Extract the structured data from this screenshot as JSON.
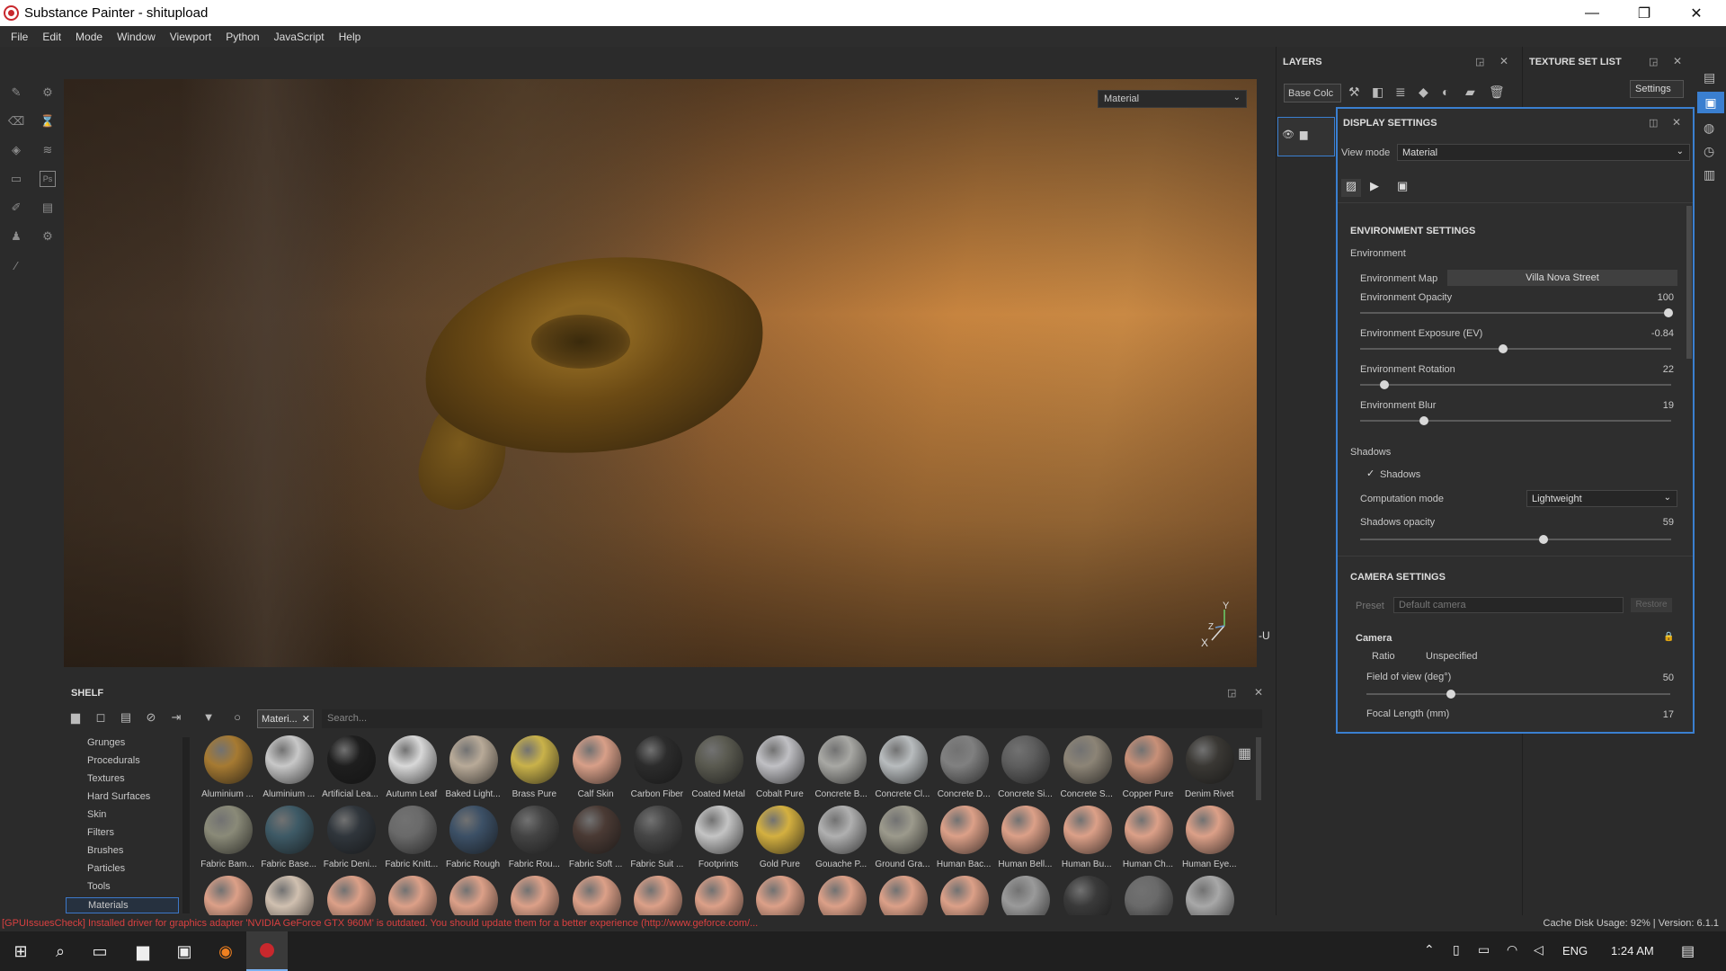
{
  "window": {
    "title": "Substance Painter - shitupload",
    "minimize": "—",
    "maximize": "❐",
    "close": "✕"
  },
  "menu": [
    "File",
    "Edit",
    "Mode",
    "Window",
    "Viewport",
    "Python",
    "JavaScript",
    "Help"
  ],
  "viewport": {
    "mode_dropdown": "Material",
    "axis_y": "Y",
    "axis_z": "Z",
    "axis_x": "X",
    "axis_u": "-U"
  },
  "shelf": {
    "title": "SHELF",
    "filter_chip": "Materi...",
    "search_placeholder": "Search...",
    "categories": [
      "Grunges",
      "Procedurals",
      "Textures",
      "Hard Surfaces",
      "Skin",
      "Filters",
      "Brushes",
      "Particles",
      "Tools",
      "Materials"
    ],
    "selected_category": "Materials",
    "materials_row1": [
      {
        "label": "Aluminium ...",
        "color": "#a67a32"
      },
      {
        "label": "Aluminium ...",
        "color": "#c8c8c8"
      },
      {
        "label": "Artificial Lea...",
        "color": "#1e1e1e"
      },
      {
        "label": "Autumn Leaf",
        "color": "#d8d8d8"
      },
      {
        "label": "Baked Light...",
        "color": "#b8aa98"
      },
      {
        "label": "Brass Pure",
        "color": "#c9b24a"
      },
      {
        "label": "Calf Skin",
        "color": "#d89f88"
      },
      {
        "label": "Carbon Fiber",
        "color": "#2c2c2c"
      },
      {
        "label": "Coated Metal",
        "color": "#5a5a50"
      },
      {
        "label": "Cobalt Pure",
        "color": "#c0c0c4"
      },
      {
        "label": "Concrete B...",
        "color": "#a8a8a4"
      },
      {
        "label": "Concrete Cl...",
        "color": "#b8bcbe"
      },
      {
        "label": "Concrete D...",
        "color": "#808080"
      },
      {
        "label": "Concrete Si...",
        "color": "#5e5e5e"
      },
      {
        "label": "Concrete S...",
        "color": "#8c8476"
      },
      {
        "label": "Copper Pure",
        "color": "#c89078"
      },
      {
        "label": "Denim Rivet",
        "color": "#3a3834"
      }
    ],
    "materials_row2": [
      {
        "label": "Fabric Bam...",
        "color": "#8a8a78"
      },
      {
        "label": "Fabric Base...",
        "color": "#3e5a66"
      },
      {
        "label": "Fabric Deni...",
        "color": "#30363c"
      },
      {
        "label": "Fabric Knitt...",
        "color": "#6a6a6a"
      },
      {
        "label": "Fabric Rough",
        "color": "#3c5066"
      },
      {
        "label": "Fabric Rou...",
        "color": "#444444"
      },
      {
        "label": "Fabric Soft ...",
        "color": "#4a3a34"
      },
      {
        "label": "Fabric Suit ...",
        "color": "#464646"
      },
      {
        "label": "Footprints",
        "color": "#c4c4c4"
      },
      {
        "label": "Gold Pure",
        "color": "#d4b040"
      },
      {
        "label": "Gouache P...",
        "color": "#b0b0b0"
      },
      {
        "label": "Ground Gra...",
        "color": "#9c9a8c"
      },
      {
        "label": "Human Bac...",
        "color": "#dca088"
      },
      {
        "label": "Human Bell...",
        "color": "#dca088"
      },
      {
        "label": "Human Bu...",
        "color": "#dca088"
      },
      {
        "label": "Human Ch...",
        "color": "#dca088"
      },
      {
        "label": "Human Eye...",
        "color": "#dca088"
      }
    ],
    "materials_row3": [
      "#dca088",
      "#d0c0b0",
      "#dca088",
      "#dca088",
      "#dca088",
      "#dca088",
      "#dca088",
      "#dca088",
      "#dca088",
      "#dca088",
      "#dca088",
      "#dca088",
      "#dca088",
      "#9a9a9a",
      "#3a3a3a",
      "#6a6a6a",
      "#a8a8a8"
    ]
  },
  "layers": {
    "title": "LAYERS",
    "channel": "Base Colc"
  },
  "texture_set": {
    "title": "TEXTURE SET LIST",
    "settings": "Settings"
  },
  "display_settings": {
    "title": "DISPLAY SETTINGS",
    "view_mode_label": "View mode",
    "view_mode": "Material",
    "env_section": "ENVIRONMENT SETTINGS",
    "env_group": "Environment",
    "env_map_label": "Environment Map",
    "env_map": "Villa Nova Street",
    "sliders": [
      {
        "label": "Environment Opacity",
        "value": "100",
        "fraction": 1.0
      },
      {
        "label": "Environment Exposure (EV)",
        "value": "-0.84",
        "fraction": 0.46
      },
      {
        "label": "Environment Rotation",
        "value": "22",
        "fraction": 0.07
      },
      {
        "label": "Environment Blur",
        "value": "19",
        "fraction": 0.2
      }
    ],
    "shadows_group": "Shadows",
    "shadows_checkbox": "Shadows",
    "check": "✓",
    "computation_label": "Computation mode",
    "computation_mode": "Lightweight",
    "shadows_opacity_label": "Shadows opacity",
    "shadows_opacity": "59",
    "shadows_opacity_fraction": 0.59,
    "camera_section": "CAMERA SETTINGS",
    "preset_label": "Preset",
    "preset_placeholder": "Default camera",
    "restore": "Restore",
    "camera_group": "Camera",
    "ratio_label": "Ratio",
    "ratio": "Unspecified",
    "fov_label": "Field of view (deg°)",
    "fov": "50",
    "fov_fraction": 0.27,
    "focal_label": "Focal Length (mm)",
    "focal": "17"
  },
  "status": {
    "warning": "[GPUIssuesCheck] Installed driver for graphics adapter 'NVIDIA GeForce GTX 960M' is outdated. You should update them for a better experience (http://www.geforce.com/...",
    "cache": "Cache Disk Usage:     92% | Version: 6.1.1"
  },
  "taskbar": {
    "lang": "ENG",
    "time": "1:24 AM"
  },
  "icons": {
    "start": "windows-logo-icon",
    "search": "search-icon",
    "taskview": "task-view-icon",
    "explorer": "folder-icon"
  }
}
